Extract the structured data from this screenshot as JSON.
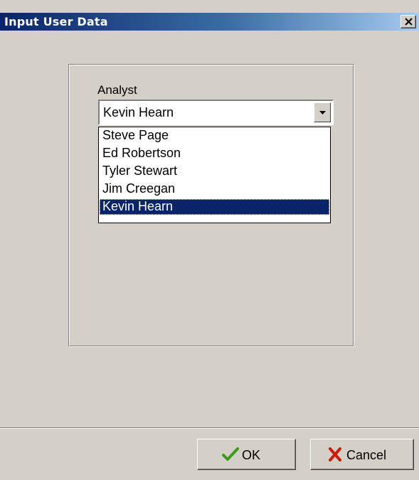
{
  "window": {
    "title": "Input User Data"
  },
  "form": {
    "analyst_label": "Analyst",
    "analyst_selected": "Kevin Hearn",
    "analyst_options": [
      "Steve Page",
      "Ed Robertson",
      "Tyler Stewart",
      "Jim Creegan",
      "Kevin Hearn"
    ],
    "highlighted_index": 4
  },
  "buttons": {
    "ok_label": "OK",
    "cancel_label": "Cancel"
  },
  "icons": {
    "ok": "checkmark-icon",
    "cancel": "x-cross-icon",
    "close": "close-icon",
    "dropdown": "dropdown-arrow-icon"
  },
  "colors": {
    "titlebar_start": "#0a246a",
    "selection": "#0a246a",
    "ok_icon": "#3c9a1e",
    "cancel_icon": "#c81e0a"
  }
}
